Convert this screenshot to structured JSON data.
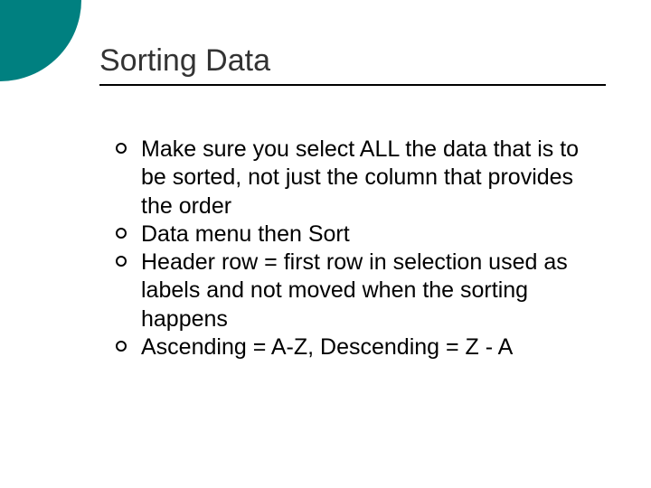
{
  "slide": {
    "title": "Sorting Data",
    "bullets": [
      "Make sure you select ALL the data that is to be sorted, not just the column that provides the order",
      "Data menu then Sort",
      "Header row = first row in selection used as labels and not moved when the sorting happens",
      "Ascending = A-Z, Descending = Z - A"
    ]
  },
  "theme": {
    "accent": "#008080"
  }
}
